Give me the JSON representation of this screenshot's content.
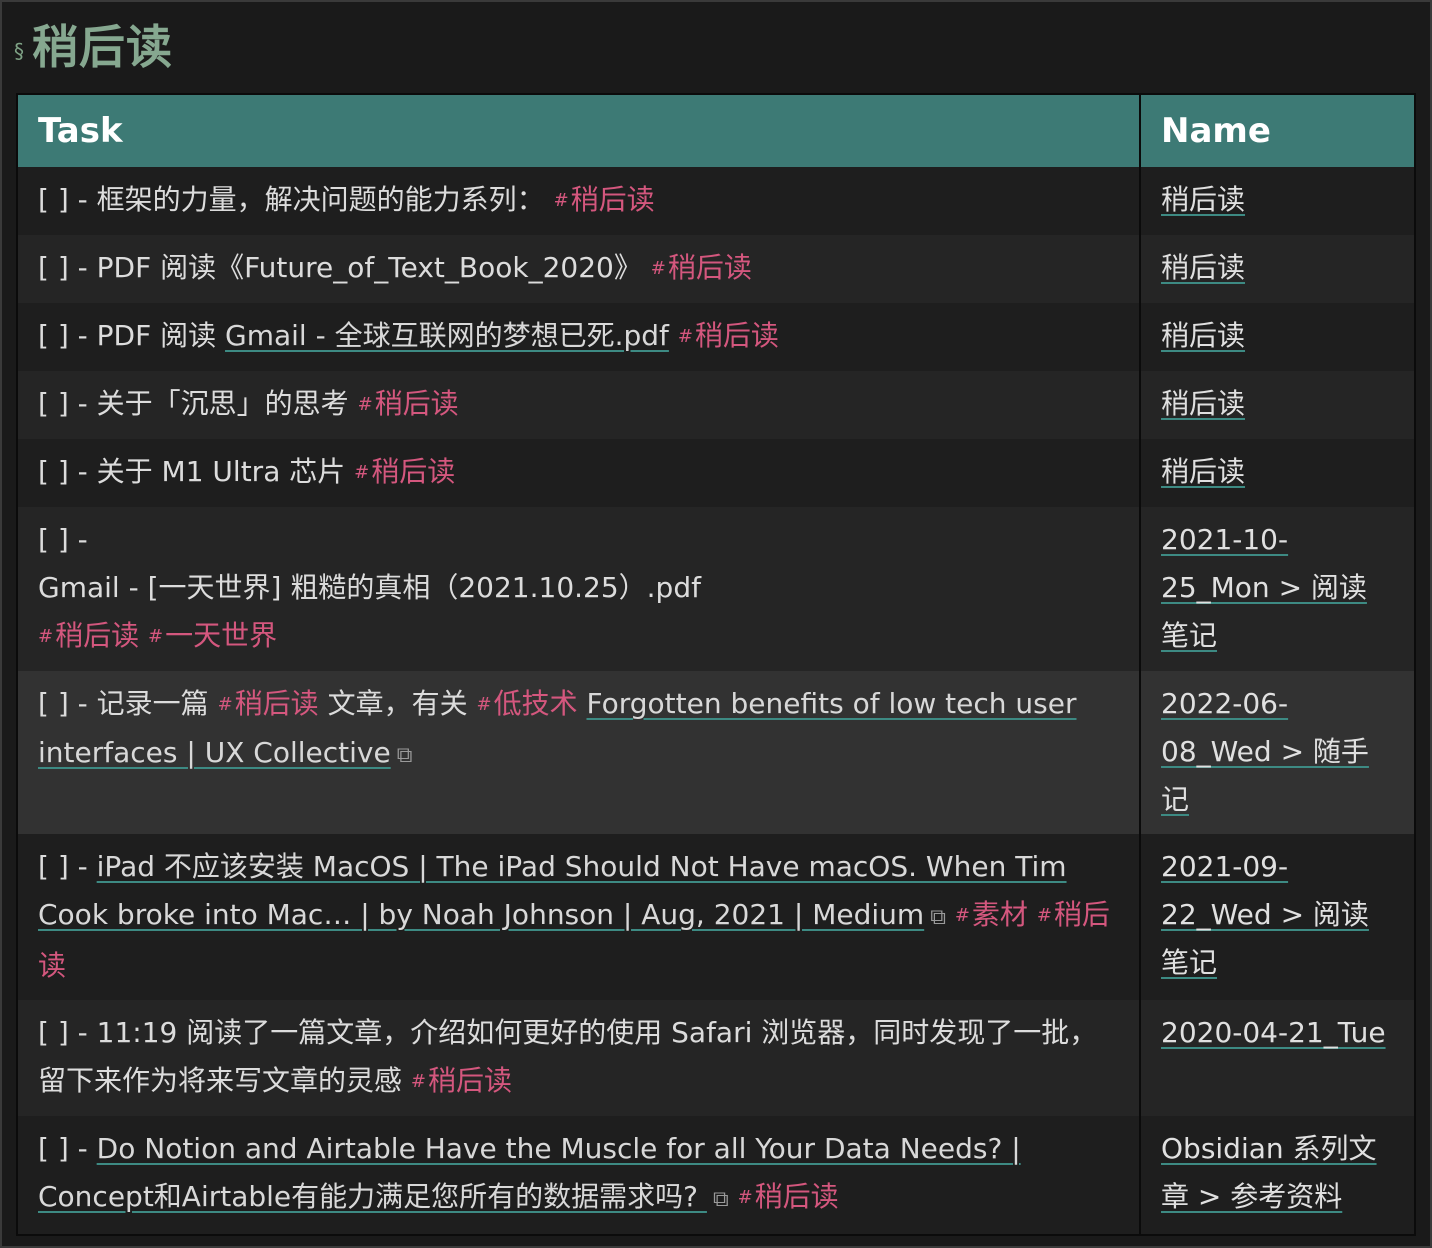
{
  "heading": {
    "symbol": "§",
    "title": "稍后读"
  },
  "table": {
    "headers": {
      "task": "Task",
      "name": "Name"
    },
    "rows": [
      {
        "prefix": "[ ] - 框架的力量，解决问题的能力系列： ",
        "tag1": "稍后读",
        "name": "稍后读"
      },
      {
        "prefix": "[ ] - PDF 阅读《Future_of_Text_Book_2020》 ",
        "tag1": "稍后读",
        "name": "稍后读"
      },
      {
        "prefix": "[ ] - PDF 阅读 ",
        "link": "Gmail - 全球互联网的梦想已死.pdf",
        "tag1": "稍后读",
        "name": "稍后读"
      },
      {
        "prefix": "[ ] - 关于「沉思」的思考 ",
        "tag1": "稍后读",
        "name": "稍后读"
      },
      {
        "prefix": "[ ] - 关于 M1 Ultra 芯片 ",
        "tag1": "稍后读",
        "name": "稍后读"
      },
      {
        "prefix": "[ ] -",
        "line2": "Gmail - [一天世界] 粗糙的真相（2021.10.25）.pdf",
        "tag1": "稍后读",
        "tag2": "一天世界",
        "name": "2021-10-25_Mon > 阅读笔记"
      },
      {
        "prefix": "[ ] - 记录一篇 ",
        "tag1": "稍后读",
        "mid": " 文章，有关 ",
        "tag2": "低技术",
        "link": "Forgotten benefits of low tech user interfaces | UX Collective",
        "name": "2022-06-08_Wed > 随手记"
      },
      {
        "prefix": "[ ] - ",
        "link": "iPad 不应该安装 MacOS | The iPad Should Not Have macOS. When Tim Cook broke into Mac… | by Noah Johnson | Aug, 2021 | Medium",
        "tag1": "素材",
        "tag2": "稍后读",
        "name": "2021-09-22_Wed > 阅读笔记"
      },
      {
        "prefix": "[ ] - 11:19 阅读了一篇文章，介绍如何更好的使用 Safari 浏览器，同时发现了一批，留下来作为将来写文章的灵感 ",
        "tag1": "稍后读",
        "name": "2020-04-21_Tue"
      },
      {
        "prefix": "[ ] - ",
        "link": "Do Notion and Airtable Have the Muscle for all Your Data Needs? | Concept和Airtable有能力满足您所有的数据需求吗? ",
        "tag1": "稍后读",
        "name": "Obsidian 系列文章 > 参考资料"
      }
    ]
  },
  "icons": {
    "tag_hash": "#",
    "external_link": "⧉"
  },
  "colors": {
    "header_bg": "#3d7a75",
    "tag": "#d4577e",
    "heading": "#86a890",
    "link_underline": "#3d8a83"
  }
}
